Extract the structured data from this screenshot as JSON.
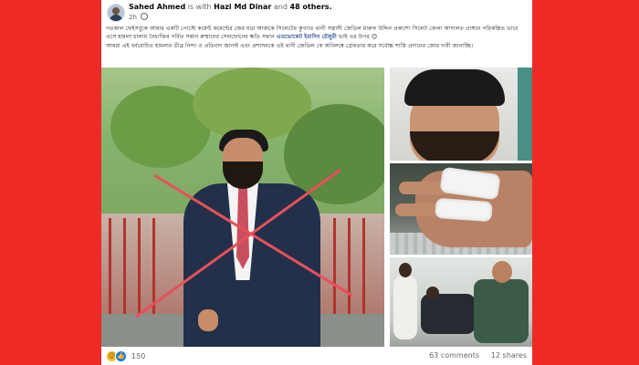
{
  "post": {
    "author": "Sahed Ahmed",
    "with_text": "is with",
    "tagged": "Hazi Md Dinar",
    "and_text": "and",
    "others": "48 others.",
    "time": "2h",
    "text_p1_a": "গতকাল ফেইসবুকে আমার একটি পোস্টে কমেন্ট কমেন্টের জের ধরে আজকে সিলেটের কুখ্যাত থানী সন্ত্রাসী জেডিল মারুফ উদ্দিন প্রকাশ্যে সিলেট জেলা আদালত প্রাঙ্গনে পরিকল্পিত ভাবে এসে হামলা চালায় বৈধ্যক্তির গর্বিত সন্তান রুম্মানের সেলফোনের ক্ষতি সন্তান",
    "mention": "এডভোকেট ইমাদিন চৌধুরী",
    "text_p1_b": "ভাই এর উপর",
    "text_p2": "আমরা এই বর্বরোচিত হামলার তীব্র নিন্দা ও প্রতিবাদ জানাই এবং প্রশাসনকে এই থানী জেডিল কে অবিলম্বে গ্রেফতার করে সর্বোচ্চ শাস্তি প্রদানের জোর দাবী জানাচ্ছি।"
  },
  "footer": {
    "reaction_count": "150",
    "comments": "63 comments",
    "shares": "12 shares"
  },
  "icons": {
    "globe": "globe-icon",
    "haha": "haha-reaction-icon",
    "like": "like-reaction-icon"
  },
  "colors": {
    "background": "#ee2a27",
    "cross": "#e8505b",
    "link": "#385898"
  }
}
